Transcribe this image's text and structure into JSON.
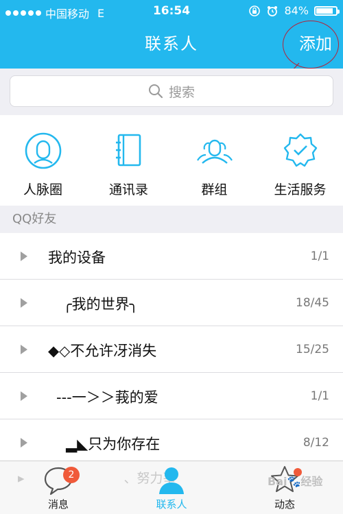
{
  "status_bar": {
    "carrier": "中国移动",
    "network": "E",
    "time": "16:54",
    "battery_percent": "84%",
    "battery_level": 0.84
  },
  "nav": {
    "title": "联系人",
    "add_label": "添加"
  },
  "search": {
    "placeholder": "搜索"
  },
  "quick_actions": [
    {
      "label": "人脉圈",
      "icon": "person-circle-icon"
    },
    {
      "label": "通讯录",
      "icon": "address-book-icon"
    },
    {
      "label": "群组",
      "icon": "group-icon"
    },
    {
      "label": "生活服务",
      "icon": "verified-badge-icon"
    }
  ],
  "group_header": "QQ好友",
  "groups": [
    {
      "name": "我的设备",
      "count": "1/1"
    },
    {
      "name": "╭我的世界╮",
      "count": "18/45"
    },
    {
      "name": "◆◇不允许冴消失",
      "count": "15/25"
    },
    {
      "name": "---一＞＞莪的爱",
      "count": "1/1"
    },
    {
      "name": "▂◣只为你存在",
      "count": "8/12"
    }
  ],
  "partial_row": "、努力莘",
  "tabbar": {
    "tabs": [
      {
        "label": "消息",
        "icon": "chat-bubble-icon",
        "badge": "2"
      },
      {
        "label": "联系人",
        "icon": "contacts-person-icon",
        "active": true
      },
      {
        "label": "动态",
        "icon": "star-icon"
      }
    ]
  },
  "watermark": "Bai🐾经验",
  "colors": {
    "accent": "#23b8ee",
    "badge": "#f05a3a",
    "annotation": "#b4233a"
  }
}
